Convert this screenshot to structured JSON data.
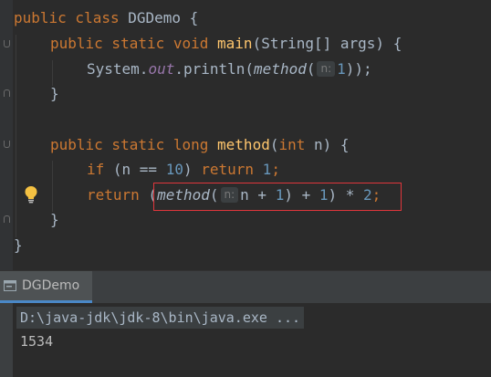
{
  "editor": {
    "lines": [
      {
        "kw": "public class ",
        "name": "DGDemo",
        "rest": " {"
      },
      {
        "kw": "public static void ",
        "fn": "main",
        "params": "(String[] args) {"
      },
      {
        "pre": "System.",
        "field": "out",
        "call": ".println(",
        "method": "method",
        "open": "(",
        "hint": "n:",
        "arg": "1",
        "close": "));"
      },
      {
        "brace": "}"
      },
      {
        "kw": "public static long ",
        "fn": "method",
        "params_open": "(",
        "param_kw": "int",
        "params_rest": " n) {"
      },
      {
        "kw_if": "if",
        "cond_open": " (n == ",
        "num": "10",
        "cond_close": ") ",
        "kw_return": "return",
        "sp": " ",
        "val": "1",
        "semi": ";"
      },
      {
        "kw_return": "return",
        "open": " (",
        "method": "method",
        "paren": "(",
        "hint": "n:",
        "expr": "n + ",
        "one1": "1",
        "mid": ") + ",
        "one2": "1",
        "mid2": ") * ",
        "two": "2",
        "semi": ";"
      },
      {
        "brace": "}"
      },
      {
        "brace": "}"
      }
    ]
  },
  "run_panel": {
    "tab_label": "DGDemo",
    "command": "D:\\java-jdk\\jdk-8\\bin\\java.exe ...",
    "output": "1534"
  },
  "icons": [
    "lightbulb-icon",
    "run-config-icon",
    "fold-marker-icon"
  ],
  "colors": {
    "keyword": "#cc7832",
    "function": "#ffc66d",
    "number": "#6897bb",
    "field": "#9876aa",
    "highlight_border": "#e0363c"
  }
}
